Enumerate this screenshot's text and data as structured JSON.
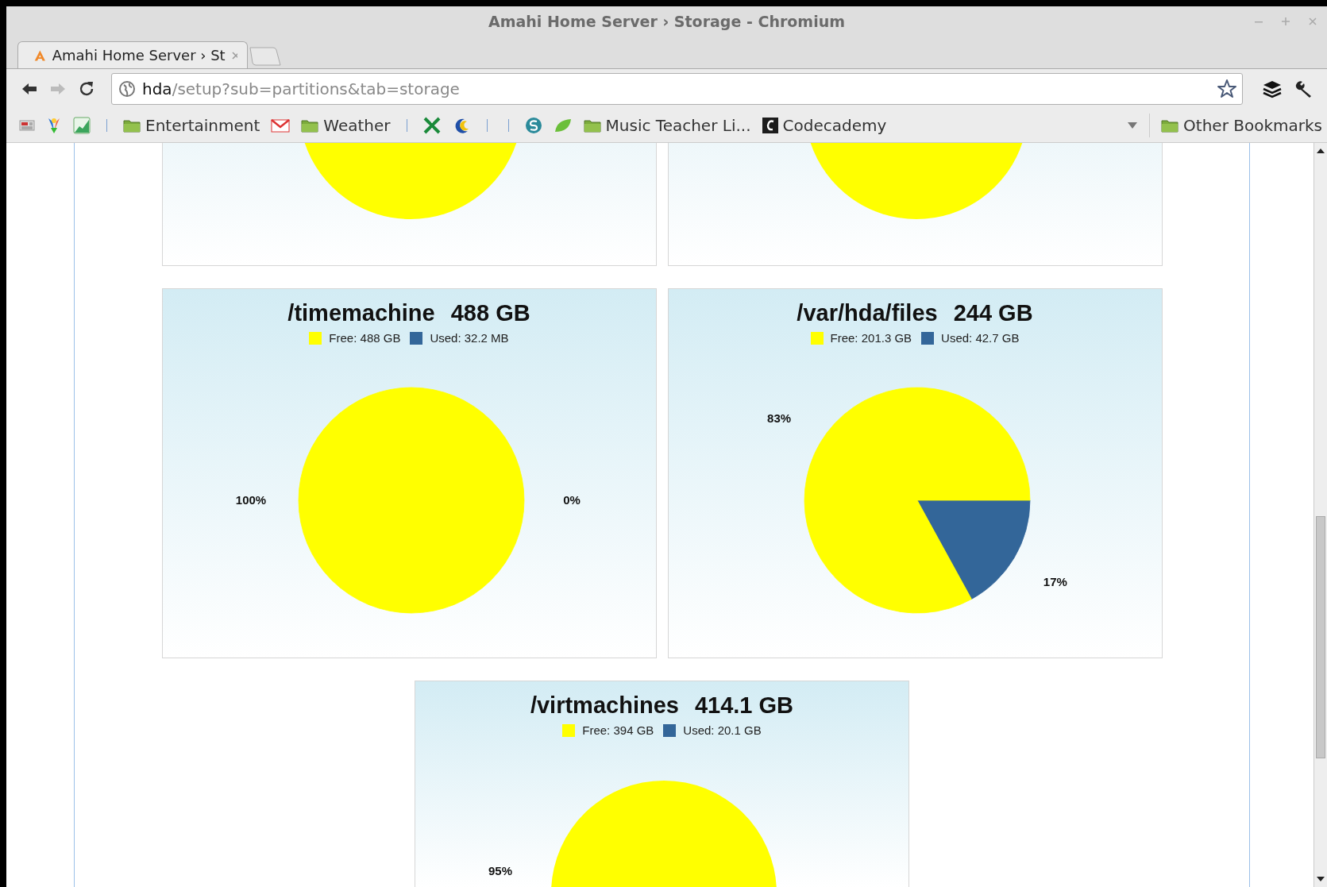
{
  "window": {
    "title": "Amahi Home Server › Storage - Chromium"
  },
  "tabs": [
    {
      "label": "Amahi Home Server › St",
      "selected": true
    }
  ],
  "toolbar": {
    "back_disabled": false,
    "forward_disabled": true
  },
  "address_bar": {
    "host": "hda",
    "path": "/setup?sub=partitions&tab=storage"
  },
  "bookmarks": [
    {
      "kind": "favicon"
    },
    {
      "kind": "favicon"
    },
    {
      "kind": "favicon"
    },
    {
      "kind": "separator"
    },
    {
      "kind": "folder",
      "label": "Entertainment"
    },
    {
      "kind": "favicon"
    },
    {
      "kind": "folder",
      "label": "Weather"
    },
    {
      "kind": "separator"
    },
    {
      "kind": "favicon"
    },
    {
      "kind": "favicon"
    },
    {
      "kind": "separator"
    },
    {
      "kind": "separator"
    },
    {
      "kind": "favicon"
    },
    {
      "kind": "favicon"
    },
    {
      "kind": "folder",
      "label": "Music Teacher Li..."
    },
    {
      "kind": "site",
      "label": "Codecademy"
    }
  ],
  "other_bookmarks": {
    "label": "Other Bookmarks"
  },
  "partial_cards": [
    {
      "kind": "pie-bottom"
    },
    {
      "kind": "pie-bottom"
    }
  ],
  "cards": [
    {
      "mount": "/timemachine",
      "size": "488 GB",
      "chart_data": {
        "type": "pie",
        "categories": [
          "Free: 488 GB",
          "Used: 32.2 MB"
        ],
        "values": [
          100,
          0
        ],
        "colors": [
          "#ffff00",
          "#336699"
        ],
        "value_labels": [
          "100%",
          "0%"
        ]
      }
    },
    {
      "mount": "/var/hda/files",
      "size": "244 GB",
      "chart_data": {
        "type": "pie",
        "categories": [
          "Free: 201.3 GB",
          "Used: 42.7 GB"
        ],
        "values": [
          83,
          17
        ],
        "colors": [
          "#ffff00",
          "#336699"
        ],
        "value_labels": [
          "83%",
          "17%"
        ]
      }
    },
    {
      "mount": "/virtmachines",
      "size": "414.1 GB",
      "legend": [
        {
          "label": "Free: 394 GB",
          "color": "#ffff00"
        },
        {
          "label": "Used: 20.1 GB",
          "color": "#336699"
        }
      ],
      "visible_label": "95%"
    }
  ]
}
